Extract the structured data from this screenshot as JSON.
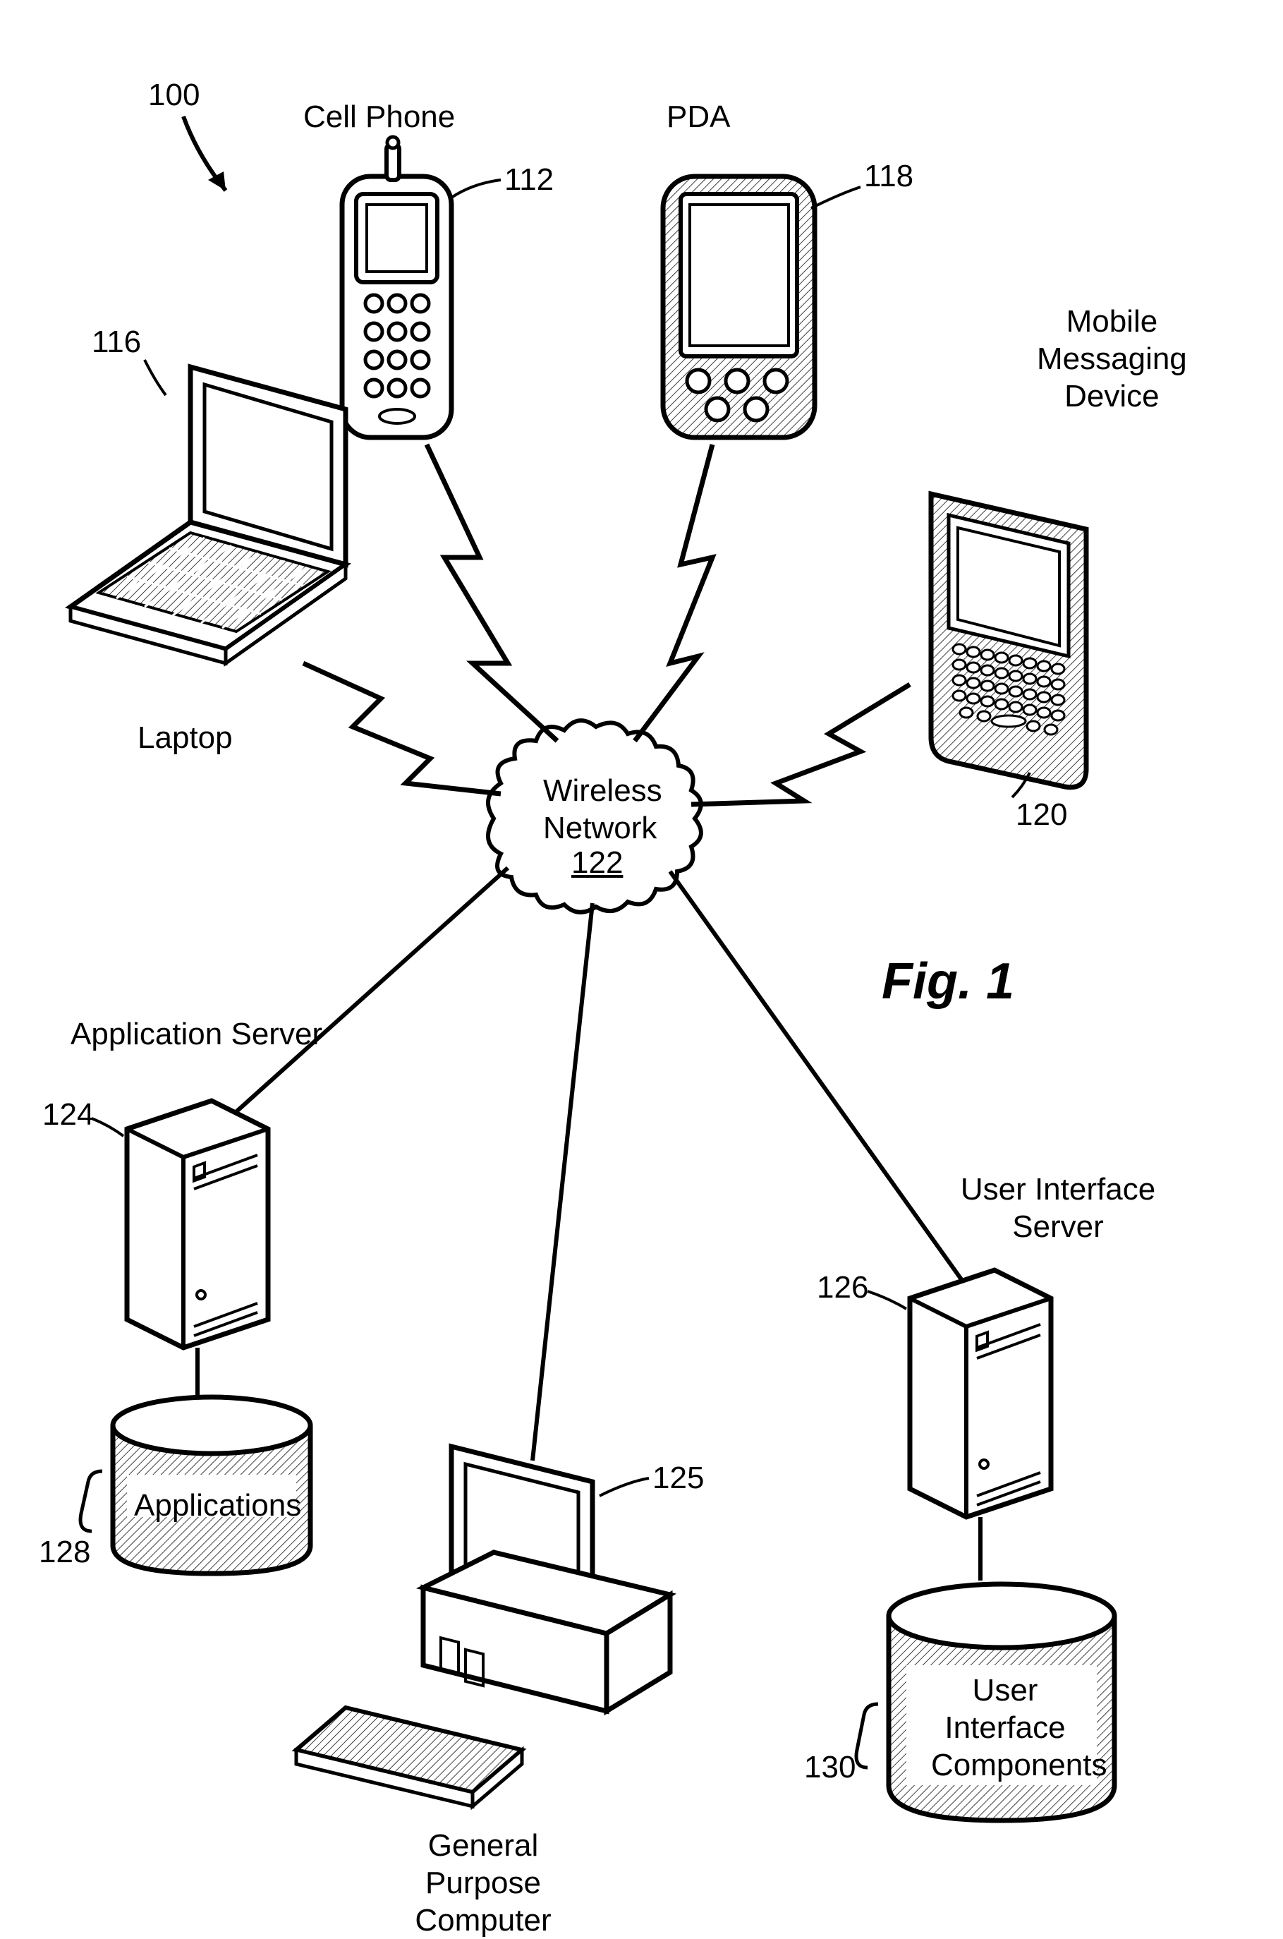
{
  "figure_label": "Fig. 1",
  "system_ref": "100",
  "nodes": {
    "cellphone": {
      "label": "Cell Phone",
      "ref": "112"
    },
    "pda": {
      "label": "PDA",
      "ref": "118"
    },
    "laptop": {
      "label": "Laptop",
      "ref": "116"
    },
    "mobile_msg": {
      "label": "Mobile\nMessaging\nDevice",
      "ref": "120"
    },
    "wireless_network": {
      "label": "Wireless\nNetwork",
      "ref": "122"
    },
    "app_server": {
      "label": "Application Server",
      "ref": "124"
    },
    "ui_server": {
      "label": "User Interface\nServer",
      "ref": "126"
    },
    "gpc": {
      "label": "General Purpose\nComputer",
      "ref": "125"
    },
    "applications_db": {
      "label": "Applications",
      "ref": "128"
    },
    "ui_components_db": {
      "label": "User\nInterface\nComponents",
      "ref": "130"
    }
  }
}
